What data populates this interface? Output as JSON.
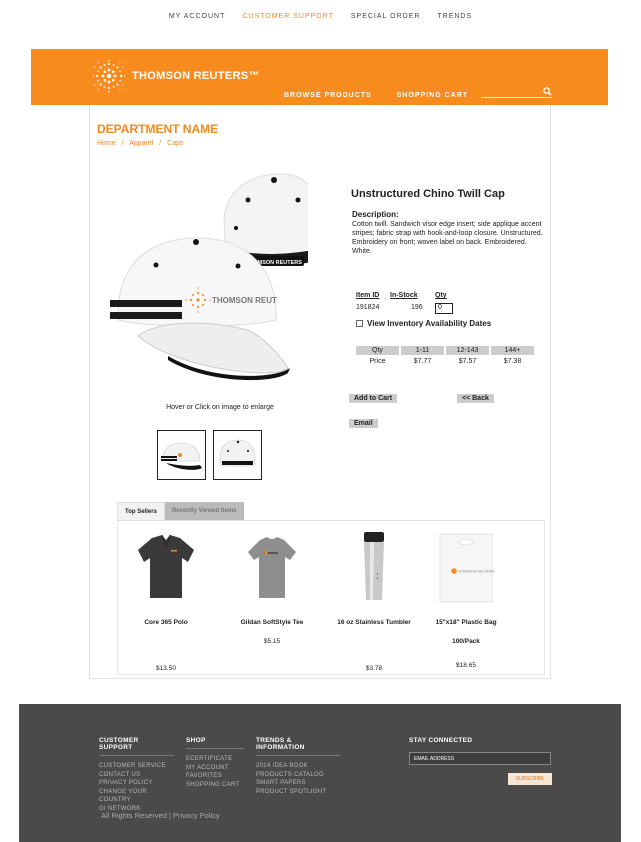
{
  "top_nav": [
    "MY ACCOUNT",
    "CUSTOMER SUPPORT",
    "SPECIAL ORDER",
    "TRENDS"
  ],
  "header": {
    "brand": "THOMSON REUTERS™",
    "nav": [
      "BROWSE PRODUCTS",
      "SHOPPING CART"
    ],
    "search_placeholder": ""
  },
  "department": "DEPARTMENT NAME",
  "breadcrumb": [
    "Home",
    "/",
    "Apparel",
    "/",
    "Caps"
  ],
  "product": {
    "title": "Unstructured Chino Twill Cap",
    "description_label": "Description:",
    "description": "Cotton twill. Sandwich visor edge insert; side applique accent stripes; fabric strap with hook-and-loop closure. Unstructured. Embroidery on front; woven label on back. Embroidered. White.",
    "cap_logo_text": "THOMSON REUT",
    "strap_text": "THOMSON REUTERS",
    "hover_hint": "Hover or Click on image to enlarge"
  },
  "inventory": {
    "headers": [
      "Item ID",
      "In-Stock",
      "Qty"
    ],
    "item_id": "191824",
    "in_stock": "196",
    "qty": "0",
    "availability_label": "View Inventory Availability Dates"
  },
  "pricing": {
    "headers": [
      "Qty",
      "1-11",
      "12-143",
      "144+"
    ],
    "row": [
      "Price",
      "$7.77",
      "$7.57",
      "$7.38"
    ]
  },
  "buttons": {
    "add_to_cart": "Add to Cart",
    "back": "<< Back",
    "email": "Email"
  },
  "tabs": [
    "Top Sellers",
    "Recently Viewed Items"
  ],
  "top_sellers": [
    {
      "name": "Core 365 Polo",
      "sub": "",
      "price": "$13.50"
    },
    {
      "name": "Gildan SoftStyle Tee",
      "sub": "$5.15",
      "price": ""
    },
    {
      "name": "16 oz Stainless Tumbler",
      "sub": "",
      "price": "$3.78"
    },
    {
      "name": "15\"x18\" Plastic Bag",
      "sub": "100/Pack",
      "price": "$18.65"
    }
  ],
  "bag_label": "THOMSON REUTERS",
  "footer": {
    "columns": [
      {
        "heading": "CUSTOMER SUPPORT",
        "links": [
          "CUSTOMER SERVICE",
          "CONTACT US",
          "PRIVACY POLICY",
          "CHANGE YOUR COUNTRY",
          "GI NETWORK"
        ]
      },
      {
        "heading": "SHOP",
        "links": [
          "ECERTIFICATE",
          "MY ACCOUNT",
          "FAVORITES",
          "SHOPPING CART"
        ]
      },
      {
        "heading": "TRENDS & INFORMATION",
        "links": [
          "2014 IDEA BOOK",
          "PRODUCTS CATALOG",
          "SMART PAPERS",
          "PRODUCT SPOTLIGHT"
        ]
      }
    ],
    "stay_connected": "STAY CONNECTED",
    "email_placeholder": "EMAIL ADDRESS",
    "subscribe": "SUBSCRIBE",
    "copyright": "All Rights Reserved  |  Privacy Policy"
  },
  "colors": {
    "brand_orange": "#f88b1e",
    "footer_bg": "#4a4a4a"
  }
}
